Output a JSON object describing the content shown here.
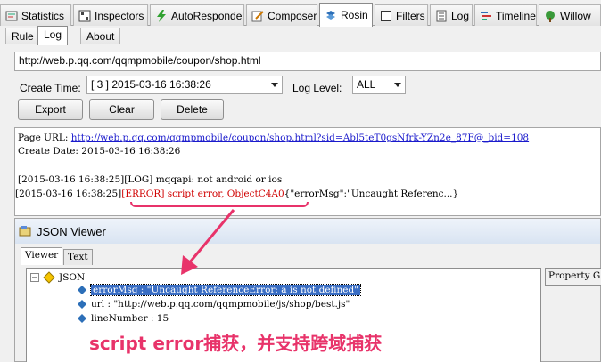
{
  "top_tabs": [
    {
      "label": "Statistics",
      "icon": "statistics-icon"
    },
    {
      "label": "Inspectors",
      "icon": "inspectors-icon"
    },
    {
      "label": "AutoResponder",
      "icon": "lightning-icon"
    },
    {
      "label": "Composer",
      "icon": "composer-icon"
    },
    {
      "label": "Rosin",
      "icon": "rosin-icon"
    },
    {
      "label": "Filters",
      "icon": "checkbox-icon"
    },
    {
      "label": "Log",
      "icon": "log-icon"
    },
    {
      "label": "Timeline",
      "icon": "timeline-icon"
    },
    {
      "label": "Willow",
      "icon": "willow-icon"
    }
  ],
  "sub_tabs": [
    "Rule",
    "Log",
    "About"
  ],
  "url": "http://web.p.qq.com/qqmpmobile/coupon/shop.html",
  "create_time_label": "Create Time:",
  "create_time_value": "[ 3 ] 2015-03-16 16:38:26",
  "log_level_label": "Log Level:",
  "log_level_value": "ALL",
  "buttons": {
    "export": "Export",
    "clear": "Clear",
    "delete": "Delete"
  },
  "log": {
    "page_url_label": "Page URL:",
    "page_url": "http://web.p.qq.com/qqmpmobile/coupon/shop.html?sid=Abl5teT0gsNfrk-YZn2e_87F@_bid=108",
    "create_date": "Create Date: 2015-03-16 16:38:26",
    "line1": "[2015-03-16 16:38:25][LOG] mqqapi: not android or ios",
    "line2_prefix": "[2015-03-16 16:38:25]",
    "line2_error": "[ERROR] script error, ObjectC4A0",
    "line2_rest": "{\"errorMsg\":\"Uncaught Referenc...}"
  },
  "json_viewer": {
    "title": "JSON Viewer",
    "tabs": [
      "Viewer",
      "Text"
    ],
    "root": "JSON",
    "nodes": [
      "errorMsg : \"Uncaught ReferenceError: a is not defined\"",
      "url : \"http://web.p.qq.com/qqmpmobile/js/shop/best.js\"",
      "lineNumber : 15"
    ],
    "property_grid": "Property G"
  },
  "caption": "script error捕获，并支持跨域捕获",
  "colors": {
    "accent": "#e8336a",
    "error": "#d00000",
    "link": "#1a1acc",
    "selection": "#3a6ec4"
  }
}
